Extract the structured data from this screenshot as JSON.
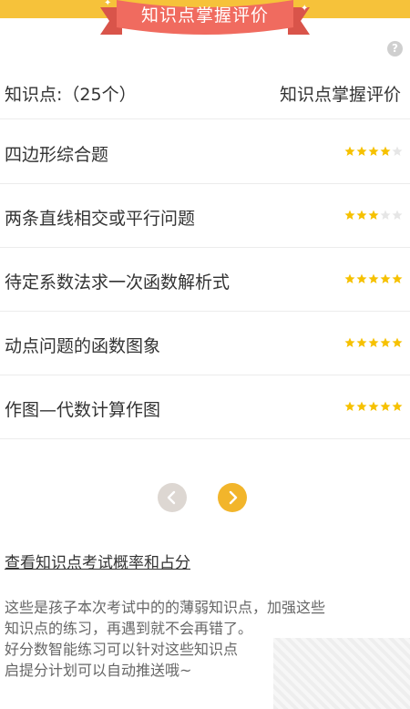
{
  "banner": {
    "title": "知识点掌握评价"
  },
  "help_icon": {
    "glyph": "?"
  },
  "header": {
    "left": "知识点:（25个）",
    "right": "知识点掌握评价"
  },
  "topics": [
    {
      "label": "四边形综合题",
      "rating": 4,
      "max": 5
    },
    {
      "label": "两条直线相交或平行问题",
      "rating": 3,
      "max": 5
    },
    {
      "label": "待定系数法求一次函数解析式",
      "rating": 5,
      "max": 5
    },
    {
      "label": "动点问题的函数图象",
      "rating": 5,
      "max": 5
    },
    {
      "label": "作图—代数计算作图",
      "rating": 5,
      "max": 5
    }
  ],
  "pager": {
    "prev_icon": "chevron-left-icon",
    "next_icon": "chevron-right-icon"
  },
  "link_text": "查看知识点考试概率和占分",
  "description": [
    "这些是孩子本次考试中的的薄弱知识点，加强这些",
    "知识点的练习，再遇到就不会再错了。",
    "好分数智能练习可以针对这些知识点",
    "启提分计划可以自动推送哦~"
  ],
  "colors": {
    "accent": "#f6c23a",
    "ribbon": "#f06b5f",
    "star_on": "#f6c100",
    "star_off": "#e6e6e6"
  }
}
